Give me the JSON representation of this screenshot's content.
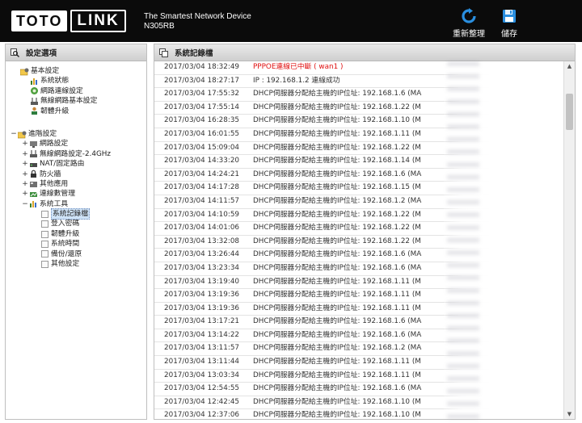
{
  "header": {
    "logo_part1": "TOTO",
    "logo_part2": "LINK",
    "tagline": "The Smartest Network Device",
    "model": "N305RB",
    "refresh_label": "重新整理",
    "save_label": "儲存"
  },
  "sidebar": {
    "title": "設定選項",
    "basic": {
      "label": "基本設定",
      "items": [
        "系統狀態",
        "網路連線設定",
        "無線網路基本設定",
        "韌體升級"
      ]
    },
    "advanced": {
      "label": "進階設定",
      "items": [
        "網路設定",
        "無線網路設定-2.4GHz",
        "NAT/固定路由",
        "防火牆",
        "其他應用",
        "連線數管理",
        "系統工具"
      ],
      "tools": [
        "系統記錄檔",
        "登入密碼",
        "韌體升級",
        "系統時間",
        "備份/還原",
        "其他設定"
      ]
    }
  },
  "log": {
    "title": "系統記錄檔",
    "rows": [
      {
        "time": "2017/03/04 18:32:49",
        "msg": "PPPOE連線已中斷 ( wan1 )",
        "alert": true
      },
      {
        "time": "2017/03/04 18:27:17",
        "msg": "IP : 192.168.1.2 連線成功",
        "alert": false
      },
      {
        "time": "2017/03/04 17:55:32",
        "msg": "DHCP伺服器分配給主機的IP位址: 192.168.1.6 (MA",
        "alert": false
      },
      {
        "time": "2017/03/04 17:55:14",
        "msg": "DHCP伺服器分配給主機的IP位址: 192.168.1.22 (M",
        "alert": false
      },
      {
        "time": "2017/03/04 16:28:35",
        "msg": "DHCP伺服器分配給主機的IP位址: 192.168.1.10 (M",
        "alert": false
      },
      {
        "time": "2017/03/04 16:01:55",
        "msg": "DHCP伺服器分配給主機的IP位址: 192.168.1.11 (M",
        "alert": false
      },
      {
        "time": "2017/03/04 15:09:04",
        "msg": "DHCP伺服器分配給主機的IP位址: 192.168.1.22 (M",
        "alert": false
      },
      {
        "time": "2017/03/04 14:33:20",
        "msg": "DHCP伺服器分配給主機的IP位址: 192.168.1.14 (M",
        "alert": false
      },
      {
        "time": "2017/03/04 14:24:21",
        "msg": "DHCP伺服器分配給主機的IP位址: 192.168.1.6 (MA",
        "alert": false
      },
      {
        "time": "2017/03/04 14:17:28",
        "msg": "DHCP伺服器分配給主機的IP位址: 192.168.1.15 (M",
        "alert": false
      },
      {
        "time": "2017/03/04 14:11:57",
        "msg": "DHCP伺服器分配給主機的IP位址: 192.168.1.2 (MA",
        "alert": false
      },
      {
        "time": "2017/03/04 14:10:59",
        "msg": "DHCP伺服器分配給主機的IP位址: 192.168.1.22 (M",
        "alert": false
      },
      {
        "time": "2017/03/04 14:01:06",
        "msg": "DHCP伺服器分配給主機的IP位址: 192.168.1.22 (M",
        "alert": false
      },
      {
        "time": "2017/03/04 13:32:08",
        "msg": "DHCP伺服器分配給主機的IP位址: 192.168.1.22 (M",
        "alert": false
      },
      {
        "time": "2017/03/04 13:26:44",
        "msg": "DHCP伺服器分配給主機的IP位址: 192.168.1.6 (MA",
        "alert": false
      },
      {
        "time": "2017/03/04 13:23:34",
        "msg": "DHCP伺服器分配給主機的IP位址: 192.168.1.6 (MA",
        "alert": false
      },
      {
        "time": "2017/03/04 13:19:40",
        "msg": "DHCP伺服器分配給主機的IP位址: 192.168.1.11 (M",
        "alert": false
      },
      {
        "time": "2017/03/04 13:19:36",
        "msg": "DHCP伺服器分配給主機的IP位址: 192.168.1.11 (M",
        "alert": false
      },
      {
        "time": "2017/03/04 13:19:36",
        "msg": "DHCP伺服器分配給主機的IP位址: 192.168.1.11 (M",
        "alert": false
      },
      {
        "time": "2017/03/04 13:17:21",
        "msg": "DHCP伺服器分配給主機的IP位址: 192.168.1.6 (MA",
        "alert": false
      },
      {
        "time": "2017/03/04 13:14:22",
        "msg": "DHCP伺服器分配給主機的IP位址: 192.168.1.6 (MA",
        "alert": false
      },
      {
        "time": "2017/03/04 13:11:57",
        "msg": "DHCP伺服器分配給主機的IP位址: 192.168.1.2 (MA",
        "alert": false
      },
      {
        "time": "2017/03/04 13:11:44",
        "msg": "DHCP伺服器分配給主機的IP位址: 192.168.1.11 (M",
        "alert": false
      },
      {
        "time": "2017/03/04 13:03:34",
        "msg": "DHCP伺服器分配給主機的IP位址: 192.168.1.11 (M",
        "alert": false
      },
      {
        "time": "2017/03/04 12:54:55",
        "msg": "DHCP伺服器分配給主機的IP位址: 192.168.1.6 (MA",
        "alert": false
      },
      {
        "time": "2017/03/04 12:42:45",
        "msg": "DHCP伺服器分配給主機的IP位址: 192.168.1.10 (M",
        "alert": false
      },
      {
        "time": "2017/03/04 12:37:06",
        "msg": "DHCP伺服器分配給主機的IP位址: 192.168.1.10 (M",
        "alert": false
      }
    ]
  },
  "colors": {
    "header_bg": "#0b0b0b",
    "alert_text": "#e01010",
    "selection": "#cfe3f7"
  }
}
